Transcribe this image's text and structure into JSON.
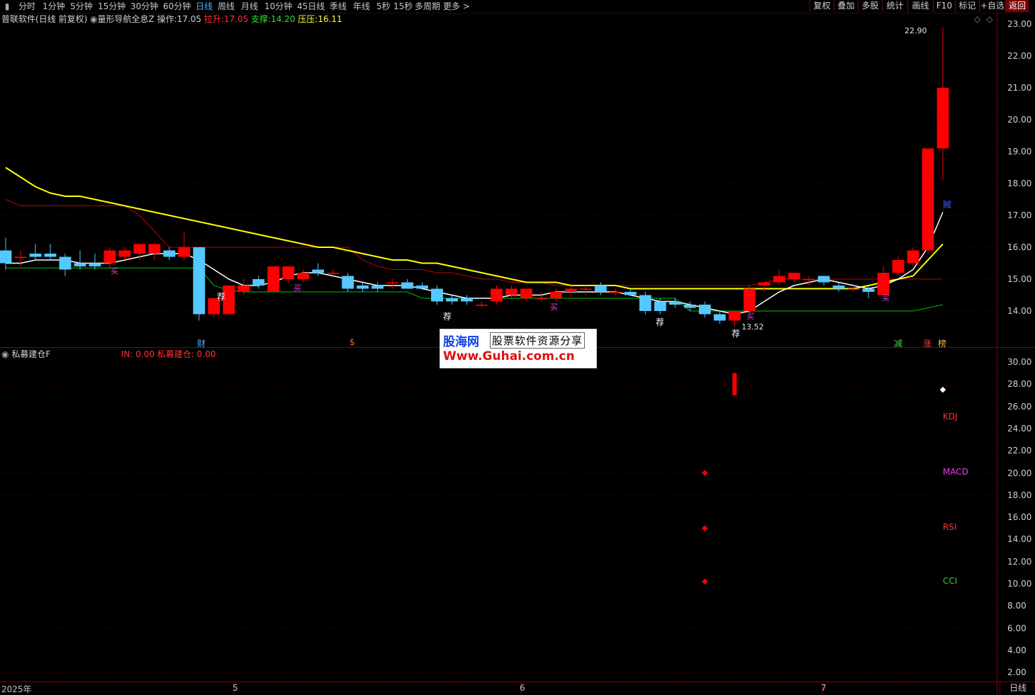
{
  "toolbar": {
    "left_icon": "panel-toggle-icon",
    "timeframes": [
      "分时",
      "1分钟",
      "5分钟",
      "15分钟",
      "30分钟",
      "60分钟",
      "日线",
      "周线",
      "月线",
      "10分钟",
      "45日线",
      "季线",
      "年线",
      "5秒",
      "15秒",
      "多周期",
      "更多 >"
    ],
    "active_timeframe": "日线",
    "right_buttons": [
      "复权",
      "叠加",
      "多股",
      "统计",
      "画线",
      "F10",
      "标记",
      "+自选",
      "返回"
    ]
  },
  "main_panel": {
    "app_name": "普联软件",
    "mode": "(日线 前复权)",
    "indicator_name": "量形导航全息Z",
    "operate_label": "操作:",
    "operate_value": "17.05",
    "pull_label": "拉升:",
    "pull_value": "17.05",
    "support_label": "支撑:",
    "support_value": "14.20",
    "pressure_label": "压压:",
    "pressure_value": "16.11",
    "high_label": "22.90",
    "low_label": "13.52",
    "y_ticks": [
      "23.00",
      "22.00",
      "21.00",
      "20.00",
      "19.00",
      "18.00",
      "17.00",
      "16.00",
      "15.00",
      "14.00"
    ],
    "markers": {
      "cai": "财",
      "dollar": "$",
      "jian": "减",
      "zhang": "涨",
      "bang": "榜",
      "jian2": "荐",
      "mai": "买",
      "dan": "贼"
    },
    "colors": {
      "up": "#ff0000",
      "down": "#54c8ff",
      "yellow": "#ffff00",
      "white": "#ffffff",
      "green": "#00c000",
      "red_line": "#d00000"
    }
  },
  "sub_panel": {
    "indicator_name": "私募建仓F",
    "in_label": "IN: 0.00",
    "build_label": "私募建仓: 0.00",
    "y_ticks": [
      "30.00",
      "28.00",
      "26.00",
      "24.00",
      "22.00",
      "20.00",
      "18.00",
      "16.00",
      "14.00",
      "12.00",
      "10.00",
      "8.00",
      "6.00",
      "4.00",
      "2.00"
    ],
    "legend": [
      {
        "name": "KDJ",
        "color": "#ff3030"
      },
      {
        "name": "MACD",
        "color": "#e040e0"
      },
      {
        "name": "RSI",
        "color": "#ff3030"
      },
      {
        "name": "CCI",
        "color": "#30d030"
      }
    ]
  },
  "date_axis": {
    "labels": [
      "2025年",
      "5",
      "6",
      "7"
    ],
    "period_button": "日线"
  },
  "chart_data": {
    "type": "candlestick",
    "y_min": 13.4,
    "y_max": 23.2,
    "candles": [
      {
        "o": 15.9,
        "h": 16.3,
        "l": 15.3,
        "c": 15.5
      },
      {
        "o": 15.7,
        "h": 15.9,
        "l": 15.4,
        "c": 15.7
      },
      {
        "o": 15.8,
        "h": 16.1,
        "l": 15.6,
        "c": 15.7
      },
      {
        "o": 15.8,
        "h": 16.1,
        "l": 15.6,
        "c": 15.7
      },
      {
        "o": 15.7,
        "h": 15.8,
        "l": 15.1,
        "c": 15.3
      },
      {
        "o": 15.5,
        "h": 15.9,
        "l": 15.3,
        "c": 15.4
      },
      {
        "o": 15.5,
        "h": 15.8,
        "l": 15.3,
        "c": 15.4
      },
      {
        "o": 15.5,
        "h": 16.0,
        "l": 15.3,
        "c": 15.9
      },
      {
        "o": 15.7,
        "h": 16.0,
        "l": 15.6,
        "c": 15.9
      },
      {
        "o": 15.8,
        "h": 16.1,
        "l": 15.6,
        "c": 16.1
      },
      {
        "o": 15.8,
        "h": 16.1,
        "l": 15.6,
        "c": 16.1
      },
      {
        "o": 15.9,
        "h": 16.0,
        "l": 15.6,
        "c": 15.7
      },
      {
        "o": 15.7,
        "h": 16.5,
        "l": 15.6,
        "c": 16.0
      },
      {
        "o": 16.0,
        "h": 16.0,
        "l": 13.7,
        "c": 13.9
      },
      {
        "o": 13.9,
        "h": 14.4,
        "l": 13.8,
        "c": 14.4
      },
      {
        "o": 13.9,
        "h": 14.8,
        "l": 13.9,
        "c": 14.8
      },
      {
        "o": 14.6,
        "h": 15.0,
        "l": 14.5,
        "c": 14.8
      },
      {
        "o": 15.0,
        "h": 15.1,
        "l": 14.7,
        "c": 14.8
      },
      {
        "o": 14.6,
        "h": 15.4,
        "l": 14.6,
        "c": 15.4
      },
      {
        "o": 15.0,
        "h": 15.4,
        "l": 14.9,
        "c": 15.4
      },
      {
        "o": 15.0,
        "h": 15.3,
        "l": 14.9,
        "c": 15.2
      },
      {
        "o": 15.3,
        "h": 15.5,
        "l": 15.1,
        "c": 15.2
      },
      {
        "o": 15.2,
        "h": 15.3,
        "l": 15.1,
        "c": 15.2
      },
      {
        "o": 15.1,
        "h": 15.2,
        "l": 14.6,
        "c": 14.7
      },
      {
        "o": 14.8,
        "h": 14.9,
        "l": 14.6,
        "c": 14.7
      },
      {
        "o": 14.8,
        "h": 14.9,
        "l": 14.6,
        "c": 14.7
      },
      {
        "o": 14.9,
        "h": 15.0,
        "l": 14.7,
        "c": 14.9
      },
      {
        "o": 14.9,
        "h": 15.0,
        "l": 14.7,
        "c": 14.7
      },
      {
        "o": 14.8,
        "h": 14.9,
        "l": 14.7,
        "c": 14.7
      },
      {
        "o": 14.7,
        "h": 14.8,
        "l": 14.2,
        "c": 14.3
      },
      {
        "o": 14.4,
        "h": 14.5,
        "l": 14.2,
        "c": 14.3
      },
      {
        "o": 14.4,
        "h": 14.5,
        "l": 14.2,
        "c": 14.3
      },
      {
        "o": 14.2,
        "h": 14.3,
        "l": 14.1,
        "c": 14.2
      },
      {
        "o": 14.3,
        "h": 14.8,
        "l": 14.2,
        "c": 14.7
      },
      {
        "o": 14.5,
        "h": 14.8,
        "l": 14.4,
        "c": 14.7
      },
      {
        "o": 14.4,
        "h": 14.7,
        "l": 14.3,
        "c": 14.7
      },
      {
        "o": 14.4,
        "h": 14.6,
        "l": 14.3,
        "c": 14.4
      },
      {
        "o": 14.4,
        "h": 14.7,
        "l": 14.3,
        "c": 14.6
      },
      {
        "o": 14.6,
        "h": 14.8,
        "l": 14.5,
        "c": 14.7
      },
      {
        "o": 14.7,
        "h": 14.8,
        "l": 14.5,
        "c": 14.7
      },
      {
        "o": 14.8,
        "h": 14.9,
        "l": 14.5,
        "c": 14.6
      },
      {
        "o": 14.6,
        "h": 14.7,
        "l": 14.5,
        "c": 14.6
      },
      {
        "o": 14.6,
        "h": 14.7,
        "l": 14.5,
        "c": 14.5
      },
      {
        "o": 14.5,
        "h": 14.6,
        "l": 13.9,
        "c": 14.0
      },
      {
        "o": 14.3,
        "h": 14.4,
        "l": 13.9,
        "c": 14.0
      },
      {
        "o": 14.3,
        "h": 14.4,
        "l": 14.1,
        "c": 14.2
      },
      {
        "o": 14.2,
        "h": 14.3,
        "l": 14.0,
        "c": 14.1
      },
      {
        "o": 14.2,
        "h": 14.3,
        "l": 13.8,
        "c": 13.9
      },
      {
        "o": 13.9,
        "h": 14.0,
        "l": 13.6,
        "c": 13.7
      },
      {
        "o": 13.7,
        "h": 14.0,
        "l": 13.5,
        "c": 14.0
      },
      {
        "o": 14.0,
        "h": 14.8,
        "l": 13.9,
        "c": 14.7
      },
      {
        "o": 14.8,
        "h": 14.9,
        "l": 14.6,
        "c": 14.9
      },
      {
        "o": 14.9,
        "h": 15.3,
        "l": 14.8,
        "c": 15.1
      },
      {
        "o": 15.0,
        "h": 15.2,
        "l": 14.9,
        "c": 15.2
      },
      {
        "o": 15.0,
        "h": 15.1,
        "l": 14.8,
        "c": 15.0
      },
      {
        "o": 15.1,
        "h": 15.1,
        "l": 14.8,
        "c": 14.9
      },
      {
        "o": 14.8,
        "h": 14.9,
        "l": 14.6,
        "c": 14.7
      },
      {
        "o": 14.7,
        "h": 14.8,
        "l": 14.6,
        "c": 14.7
      },
      {
        "o": 14.7,
        "h": 14.8,
        "l": 14.4,
        "c": 14.6
      },
      {
        "o": 14.5,
        "h": 15.4,
        "l": 14.5,
        "c": 15.2
      },
      {
        "o": 15.2,
        "h": 15.7,
        "l": 15.1,
        "c": 15.6
      },
      {
        "o": 15.5,
        "h": 16.0,
        "l": 15.4,
        "c": 15.9
      },
      {
        "o": 15.9,
        "h": 19.1,
        "l": 15.8,
        "c": 19.1
      },
      {
        "o": 19.1,
        "h": 22.9,
        "l": 18.1,
        "c": 21.0
      }
    ],
    "ma_white": [
      15.5,
      15.5,
      15.6,
      15.6,
      15.6,
      15.5,
      15.5,
      15.5,
      15.6,
      15.7,
      15.8,
      15.8,
      15.8,
      15.6,
      15.3,
      15.0,
      14.8,
      14.8,
      14.9,
      15.1,
      15.2,
      15.2,
      15.1,
      15.0,
      14.9,
      14.8,
      14.8,
      14.8,
      14.7,
      14.6,
      14.5,
      14.4,
      14.4,
      14.4,
      14.5,
      14.5,
      14.5,
      14.6,
      14.6,
      14.6,
      14.6,
      14.6,
      14.5,
      14.4,
      14.3,
      14.3,
      14.2,
      14.1,
      14.0,
      13.9,
      14.0,
      14.3,
      14.6,
      14.8,
      14.9,
      15.0,
      14.9,
      14.8,
      14.7,
      14.8,
      15.0,
      15.3,
      16.0,
      17.1
    ],
    "ma_yellow": [
      18.5,
      18.2,
      17.9,
      17.7,
      17.6,
      17.6,
      17.5,
      17.4,
      17.3,
      17.2,
      17.1,
      17.0,
      16.9,
      16.8,
      16.7,
      16.6,
      16.5,
      16.4,
      16.3,
      16.2,
      16.1,
      16.0,
      16.0,
      15.9,
      15.8,
      15.7,
      15.6,
      15.6,
      15.5,
      15.5,
      15.4,
      15.3,
      15.2,
      15.1,
      15.0,
      14.9,
      14.9,
      14.9,
      14.8,
      14.8,
      14.8,
      14.8,
      14.7,
      14.7,
      14.7,
      14.7,
      14.7,
      14.7,
      14.7,
      14.7,
      14.7,
      14.7,
      14.7,
      14.7,
      14.7,
      14.7,
      14.7,
      14.7,
      14.8,
      14.9,
      15.0,
      15.1,
      15.6,
      16.1
    ],
    "ma_red": [
      17.5,
      17.3,
      17.3,
      17.3,
      17.3,
      17.3,
      17.3,
      17.3,
      17.3,
      17.0,
      16.5,
      16.0,
      16.0,
      16.0,
      16.0,
      16.0,
      16.0,
      16.0,
      16.0,
      16.0,
      16.0,
      16.0,
      16.0,
      16.0,
      15.6,
      15.4,
      15.3,
      15.3,
      15.3,
      15.2,
      15.2,
      15.1,
      15.0,
      15.0,
      14.9,
      14.9,
      14.9,
      14.8,
      14.8,
      14.8,
      14.8,
      14.8,
      14.8,
      14.8,
      14.8,
      14.8,
      14.8,
      14.8,
      14.8,
      14.8,
      14.8,
      14.9,
      15.0,
      15.0,
      15.0,
      15.0,
      15.0,
      15.0,
      15.0,
      15.0,
      15.0,
      15.0,
      15.0,
      15.0
    ],
    "support_green": [
      15.35,
      15.35,
      15.35,
      15.35,
      15.35,
      15.35,
      15.35,
      15.35,
      15.35,
      15.35,
      15.35,
      15.35,
      15.35,
      15.35,
      14.8,
      14.65,
      14.6,
      14.6,
      14.6,
      14.6,
      14.6,
      14.6,
      14.6,
      14.6,
      14.6,
      14.6,
      14.6,
      14.6,
      14.4,
      14.4,
      14.4,
      14.4,
      14.4,
      14.4,
      14.4,
      14.4,
      14.4,
      14.4,
      14.4,
      14.4,
      14.4,
      14.4,
      14.4,
      14.4,
      14.4,
      14.4,
      14.0,
      14.0,
      14.0,
      14.0,
      14.0,
      14.0,
      14.0,
      14.0,
      14.0,
      14.0,
      14.0,
      14.0,
      14.0,
      14.0,
      14.0,
      14.0,
      14.1,
      14.2
    ],
    "sub_panel_points": {
      "bar": {
        "x_index": 49,
        "from": 27,
        "to": 29
      },
      "white_diamond": {
        "x_index": 63,
        "value": 27.5
      },
      "red_diamonds": [
        {
          "x_index": 47,
          "value": 20.0
        },
        {
          "x_index": 47,
          "value": 15.0
        },
        {
          "x_index": 47,
          "value": 10.2
        }
      ]
    }
  },
  "watermark": {
    "line1_brand": "股海网",
    "line1_text": "股票软件资源分享",
    "line2": "Www.Guhai.com.cn"
  }
}
